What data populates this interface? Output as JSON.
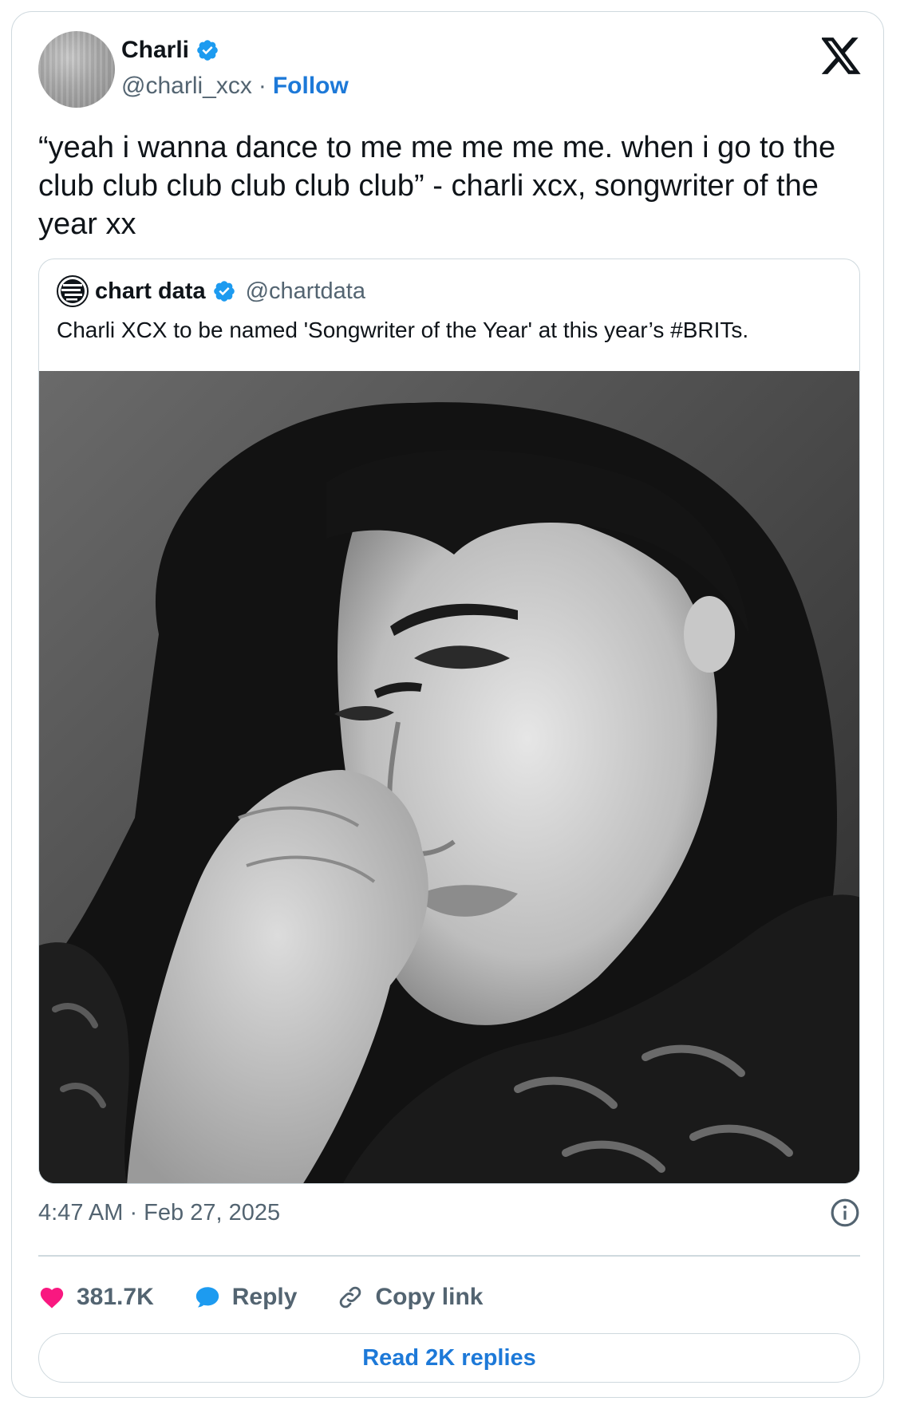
{
  "author": {
    "display_name": "Charli",
    "handle": "@charli_xcx",
    "separator": "·",
    "follow_label": "Follow",
    "verified_color": "#1d9bf0"
  },
  "tweet": {
    "text": "“yeah i wanna dance to me me me me me. when i go to the club club club club club club” - charli xcx, songwriter of the year xx"
  },
  "quoted_tweet": {
    "display_name": "chart data",
    "handle": "@chartdata",
    "text": "Charli XCX to be named 'Songwriter of the Year' at this year’s #BRITs.",
    "media": "black-and-white portrait photo"
  },
  "meta": {
    "timestamp": "4:47 AM · Feb 27, 2025"
  },
  "actions": {
    "likes": "381.7K",
    "reply_label": "Reply",
    "copy_link_label": "Copy link"
  },
  "read_replies_label": "Read 2K replies",
  "colors": {
    "link": "#1d79d8",
    "like": "#f91880",
    "reply": "#1d9bf0",
    "secondary_text": "#536471",
    "border": "#cfd9de"
  }
}
